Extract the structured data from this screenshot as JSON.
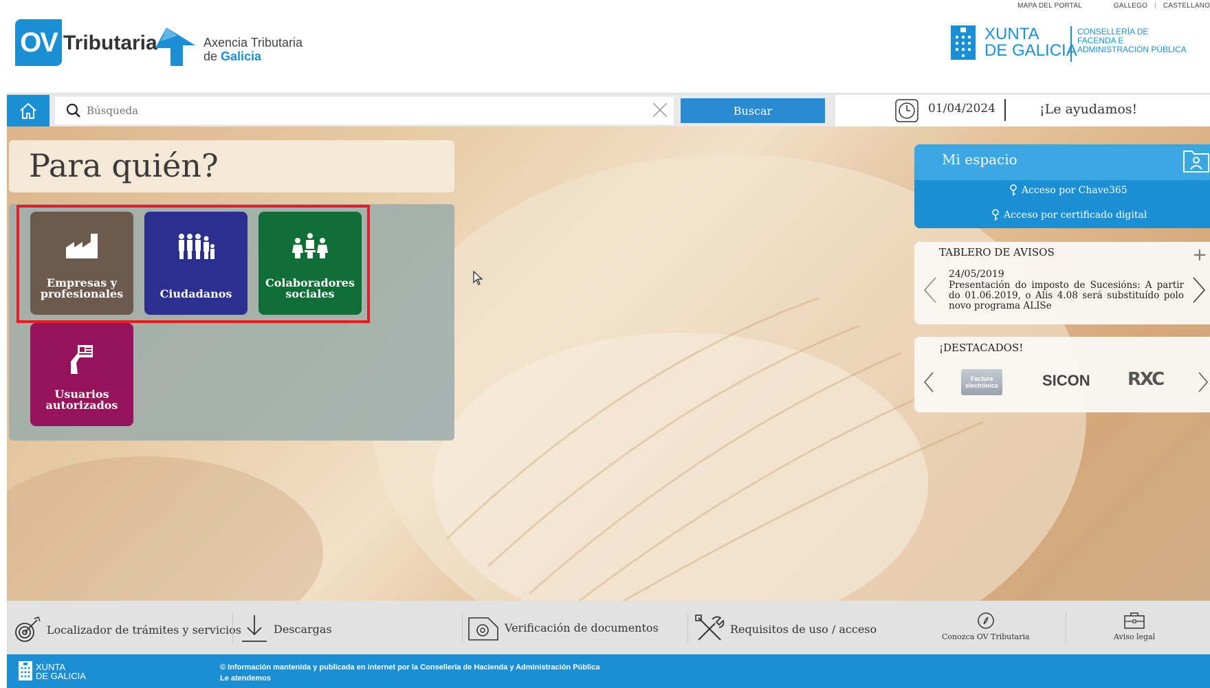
{
  "header": {
    "top_links": {
      "map": "MAPA DEL PORTAL",
      "gallego": "GALLEGO",
      "sep": "|",
      "castellano": "CASTELLANO"
    },
    "ov_badge": "OV",
    "ov_word": "Tributaria",
    "atg_line1": "Axencia Tributaria",
    "atg_line2_prefix": "de ",
    "atg_line2_bold": "Galicia",
    "xunta_line1": "XUNTA",
    "xunta_line2": "DE GALICIA",
    "conselleria": [
      "CONSELLERÍA DE",
      "FACENDA E",
      "ADMINISTRACIÓN PÚBLICA"
    ]
  },
  "searchbar": {
    "placeholder": "Búsqueda",
    "button": "Buscar",
    "date": "01/04/2024",
    "help": "¡Le ayudamos!"
  },
  "panel": {
    "title": "Para quién?",
    "tiles": [
      {
        "label1": "Empresas y",
        "label2": "profesionales",
        "color": "#6d5a4f",
        "icon": "factory-icon"
      },
      {
        "label1": "Ciudadanos",
        "label2": "",
        "color": "#2b2f8f",
        "icon": "people-icon"
      },
      {
        "label1": "Colaboradores",
        "label2": "sociales",
        "color": "#0f6e36",
        "icon": "meeting-icon"
      },
      {
        "label1": "Usuarios",
        "label2": "autorizados",
        "color": "#95135a",
        "icon": "id-card-icon"
      }
    ]
  },
  "mi_espacio": {
    "title": "Mi espacio",
    "link1": "Acceso por Chave365",
    "link2": "Acceso por certificado digital"
  },
  "tablero": {
    "title": "TABLERO DE AVISOS",
    "plus": "+",
    "date": "24/05/2019",
    "text": "Presentación do imposto de Sucesións: A partir do 01.06.2019, o Alis 4.08 será substituído polo novo programa ALISe"
  },
  "destacados": {
    "title": "¡DESTACADOS!",
    "logos": {
      "factura_l1": "Factura",
      "factura_l2": "electrónica",
      "sicon": "SICON",
      "rxc": "RXC"
    }
  },
  "footer_links": {
    "localizador": "Localizador de trámites y servicios",
    "descargas": "Descargas",
    "verificacion": "Verificación de documentos",
    "requisitos": "Requisitos de uso / acceso",
    "conozca": "Conozca OV Tributaria",
    "aviso": "Aviso legal"
  },
  "bottombar": {
    "xunta_l1": "XUNTA",
    "xunta_l2": "DE GALICIA",
    "info": "© Información mantenida y publicada en internet por la Consellería de Hacienda y Administración Pública",
    "atendemos": "Le atendemos"
  },
  "colors": {
    "brand_blue": "#1a8fd4",
    "highlight_red": "#e31e24"
  }
}
